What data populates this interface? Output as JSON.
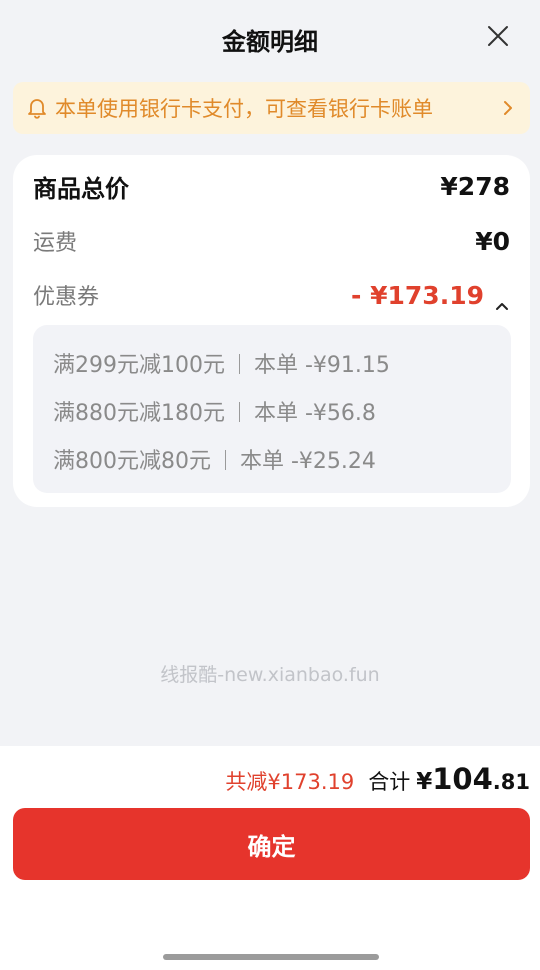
{
  "header": {
    "title": "金额明细"
  },
  "notice": {
    "text": "本单使用银行卡支付，可查看银行卡账单"
  },
  "summary_card": {
    "goods_total_label": "商品总价",
    "goods_total_value": "¥278",
    "shipping_label": "运费",
    "shipping_value": "¥0",
    "coupon_label": "优惠券",
    "coupon_value": "- ¥173.19",
    "coupons": [
      {
        "rule": "满299元减100元",
        "deduction": "本单 -¥91.15"
      },
      {
        "rule": "满880元减180元",
        "deduction": "本单 -¥56.8"
      },
      {
        "rule": "满800元减80元",
        "deduction": "本单 -¥25.24"
      }
    ]
  },
  "watermark": "线报酷-new.xianbao.fun",
  "footer": {
    "saved": "共减¥173.19",
    "total_label": "合计",
    "total_yen": "¥",
    "total_int": "104",
    "total_dec": ".81",
    "confirm_label": "确定"
  },
  "colors": {
    "accent": "#e6342c",
    "notice_bg": "#fdf3dc",
    "notice_text": "#e08a2a"
  }
}
